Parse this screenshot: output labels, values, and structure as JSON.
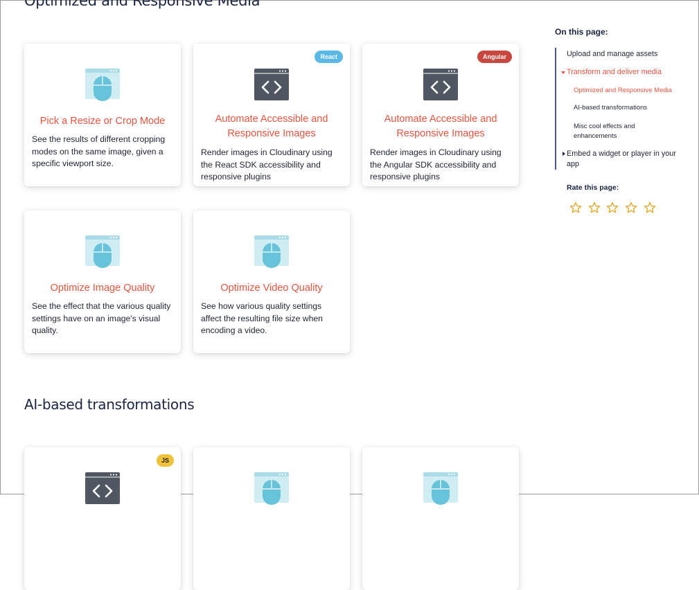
{
  "sections": [
    {
      "title": "Optimized and Responsive Media"
    },
    {
      "title": "AI-based transformations"
    }
  ],
  "cards": [
    {
      "icon": "mouse-window-icon",
      "badge": "",
      "title": "Pick a Resize or Crop Mode",
      "desc": "See the results of different cropping modes on the same image, given a specific viewport size."
    },
    {
      "icon": "code-window-icon",
      "badge": "React",
      "title": "Automate Accessible and Responsive Images",
      "desc": "Render images in Cloudinary using the React SDK accessibility and responsive plugins"
    },
    {
      "icon": "code-window-icon",
      "badge": "Angular",
      "title": "Automate Accessible and Responsive Images",
      "desc": "Render images in Cloudinary using the Angular SDK accessibility and responsive plugins"
    },
    {
      "icon": "mouse-window-icon",
      "badge": "",
      "title": "Optimize Image Quality",
      "desc": "See the effect that the various quality settings have on an image's visual quality."
    },
    {
      "icon": "mouse-window-icon",
      "badge": "",
      "title": "Optimize Video Quality",
      "desc": "See how various quality settings affect the resulting file size when encoding a video."
    },
    {
      "icon": "code-window-icon",
      "badge": "JS",
      "title": "",
      "desc": ""
    },
    {
      "icon": "mouse-window-icon",
      "badge": "",
      "title": "",
      "desc": ""
    },
    {
      "icon": "mouse-window-icon",
      "badge": "",
      "title": "",
      "desc": ""
    }
  ],
  "toc": {
    "heading": "On this page:",
    "items": [
      {
        "label": "Upload and manage assets"
      },
      {
        "label": "Transform and deliver media"
      },
      {
        "label": "Optimized and Responsive Media"
      },
      {
        "label": "AI-based transformations"
      },
      {
        "label": "Misc cool effects and enhancements"
      },
      {
        "label": "Embed a widget or player in your app"
      }
    ]
  },
  "rating": {
    "label": "Rate this page:",
    "stars": 5
  },
  "colors": {
    "accent": "#e8543f",
    "toc_border": "#4a55a7",
    "icon_light": "#a9dce8",
    "icon_dark": "#505762"
  }
}
